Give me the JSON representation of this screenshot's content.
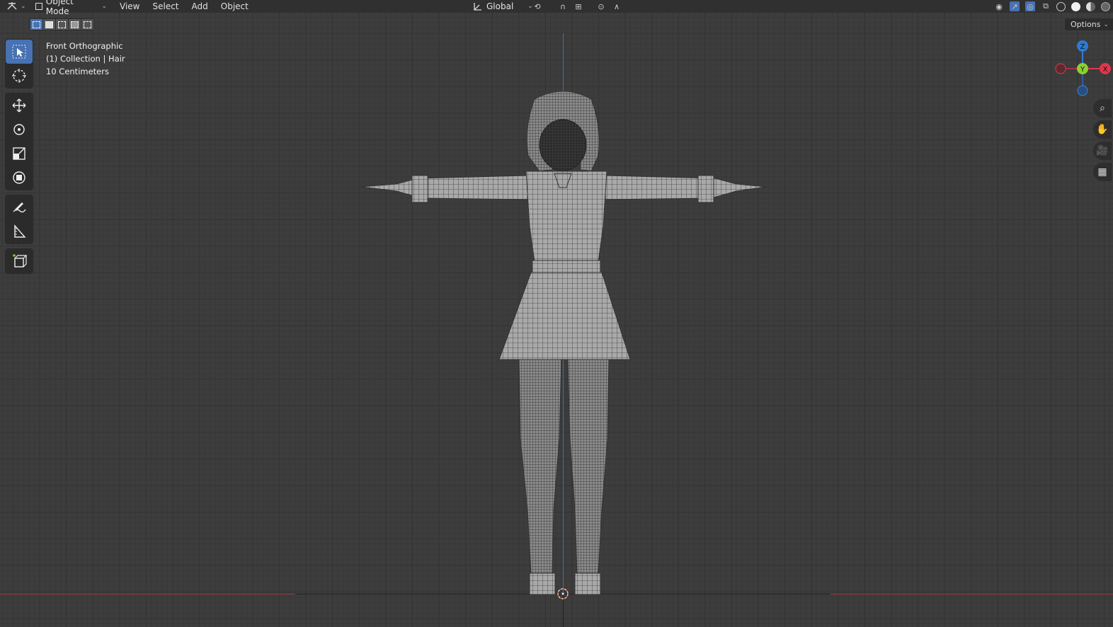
{
  "header": {
    "editor_type_icon": "3d-viewport-icon",
    "mode": "Object Mode",
    "menus": [
      "View",
      "Select",
      "Add",
      "Object"
    ],
    "transform_orientation": "Global",
    "options_label": "Options"
  },
  "viewport_info": {
    "view_name": "Front Orthographic",
    "collection_line": "(1) Collection | Hair",
    "scale_line": "10 Centimeters"
  },
  "gizmo": {
    "z_label": "Z",
    "y_label": "Y",
    "x_label": "X",
    "z_color": "#2e7bd6",
    "y_color": "#8bd12f",
    "x_color": "#e0364d"
  },
  "toolbar": {
    "tools": [
      "select-box-icon",
      "cursor-icon",
      "move-icon",
      "rotate-icon",
      "scale-icon",
      "transform-icon",
      "annotate-icon",
      "measure-icon",
      "add-cube-icon"
    ]
  },
  "navigation": {
    "icons": [
      "zoom-icon",
      "pan-hand-icon",
      "camera-icon",
      "grid-perspective-icon"
    ]
  },
  "colors": {
    "viewport_bg": "#3d3d3d",
    "header_bg": "#303030",
    "active_tool": "#4772b3",
    "x_axis_line": "#8f3a3a",
    "z_axis_line": "#3d6f99"
  }
}
